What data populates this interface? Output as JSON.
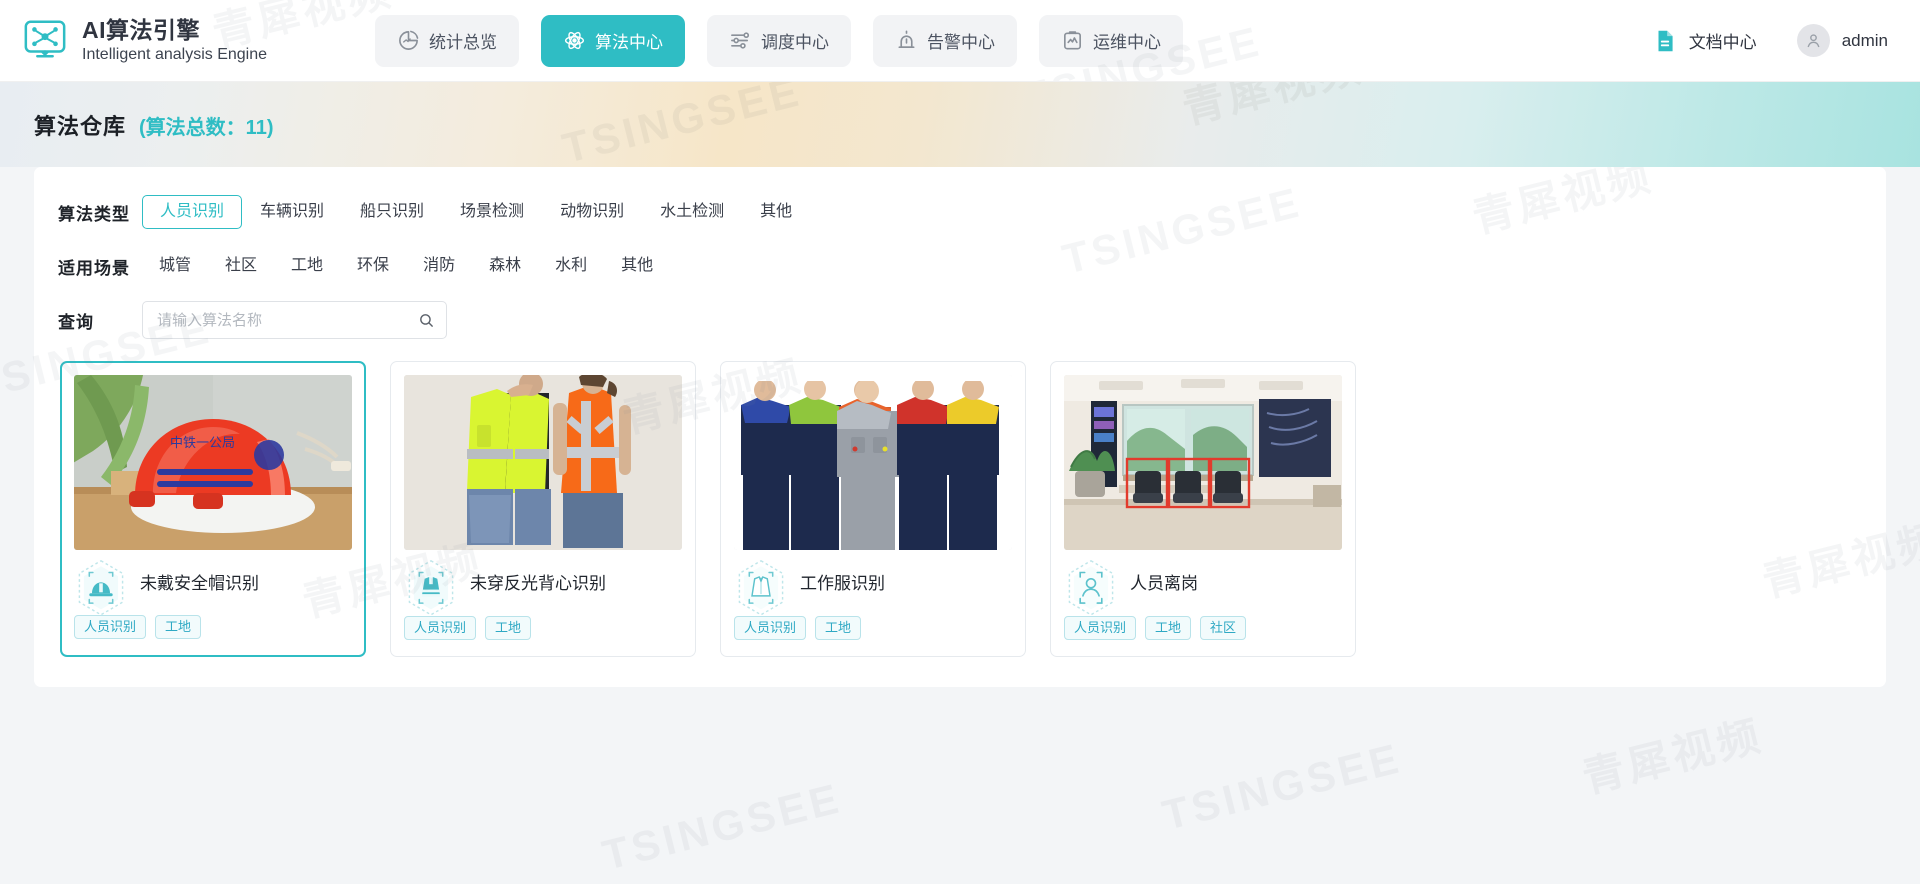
{
  "header": {
    "logo_icon": "ai-network-monitor-icon",
    "brand_title": "AI算法引擎",
    "brand_subtitle": "Intelligent analysis Engine",
    "nav": [
      {
        "label": "统计总览",
        "icon": "statistics-overview-icon",
        "active": false
      },
      {
        "label": "算法中心",
        "icon": "algorithm-atom-icon",
        "active": true
      },
      {
        "label": "调度中心",
        "icon": "sliders-icon",
        "active": false
      },
      {
        "label": "告警中心",
        "icon": "alarm-light-icon",
        "active": false
      },
      {
        "label": "运维中心",
        "icon": "ops-monitor-icon",
        "active": false
      }
    ],
    "doc_center": {
      "label": "文档中心",
      "icon": "document-icon"
    },
    "user": {
      "name": "admin",
      "icon": "user-avatar-icon"
    }
  },
  "banner": {
    "title": "算法仓库",
    "count_text": "(算法总数：11)",
    "total": 11
  },
  "filters": {
    "type": {
      "label": "算法类型",
      "selected": "人员识别",
      "options": [
        "人员识别",
        "车辆识别",
        "船只识别",
        "场景检测",
        "动物识别",
        "水土检测",
        "其他"
      ]
    },
    "scene": {
      "label": "适用场景",
      "selected": "",
      "options": [
        "城管",
        "社区",
        "工地",
        "环保",
        "消防",
        "森林",
        "水利",
        "其他"
      ]
    },
    "search": {
      "label": "查询",
      "placeholder": "请输入算法名称",
      "value": "",
      "icon": "search-icon"
    }
  },
  "cards": [
    {
      "title": "未戴安全帽识别",
      "icon": "helmet-scan-icon",
      "selected": true,
      "image": "red-safety-helmet-photo",
      "tags": [
        "人员识别",
        "工地"
      ]
    },
    {
      "title": "未穿反光背心识别",
      "icon": "vest-scan-icon",
      "selected": false,
      "image": "reflective-vest-photo",
      "tags": [
        "人员识别",
        "工地"
      ]
    },
    {
      "title": "工作服识别",
      "icon": "uniform-scan-icon",
      "selected": false,
      "image": "workwear-uniform-photo",
      "tags": [
        "人员识别",
        "工地"
      ]
    },
    {
      "title": "人员离岗",
      "icon": "person-absent-scan-icon",
      "selected": false,
      "image": "empty-office-room-photo",
      "tags": [
        "人员识别",
        "工地",
        "社区"
      ]
    }
  ],
  "watermark": {
    "brand": "TSINGSEE",
    "cn": "青犀视频"
  },
  "colors": {
    "accent": "#2fbdc4",
    "text": "#303540",
    "page_bg": "#f3f5f7",
    "tag_text": "#2fa9c4"
  }
}
